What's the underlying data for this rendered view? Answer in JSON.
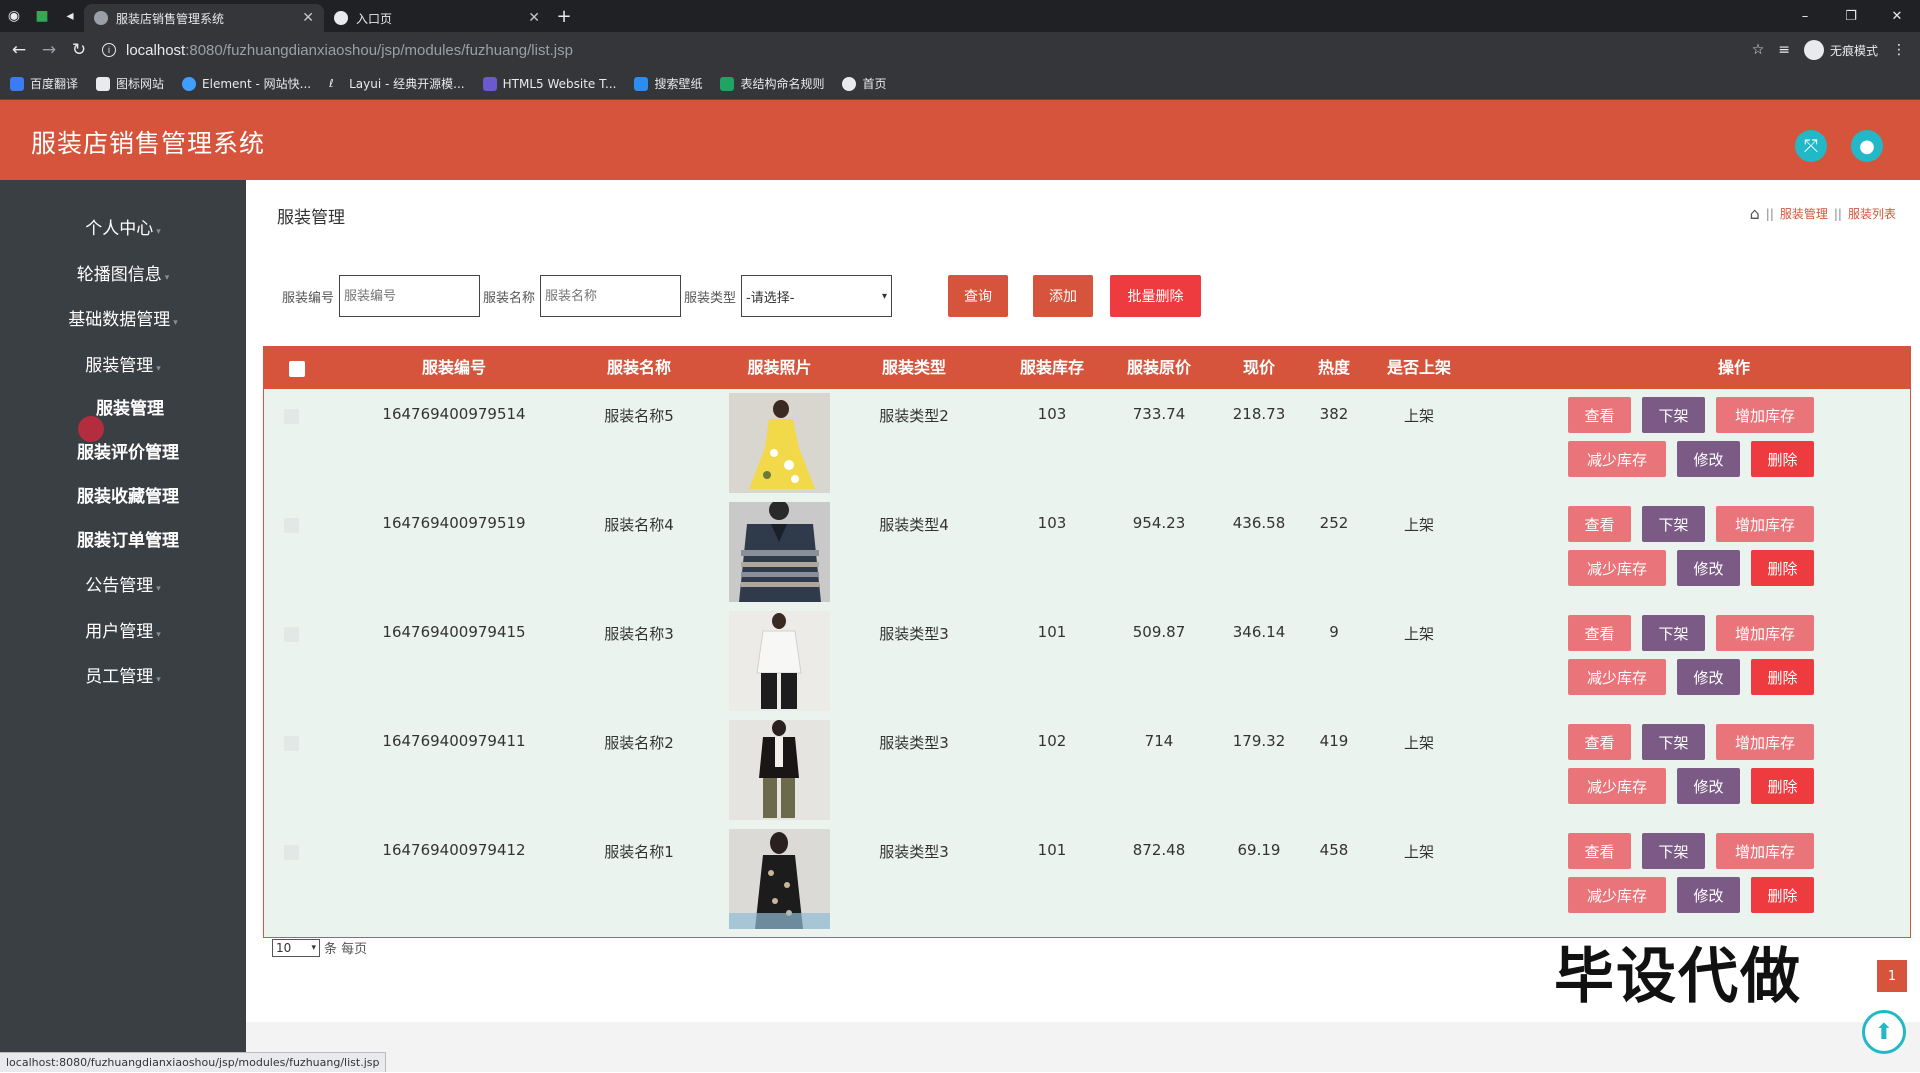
{
  "browser": {
    "tabs": [
      {
        "title": "服装店销售管理系统",
        "active": true
      },
      {
        "title": "入口页",
        "active": false
      }
    ],
    "url_host": "localhost",
    "url_path": ":8080/fuzhuangdianxiaoshou/jsp/modules/fuzhuang/list.jsp",
    "incognito_label": "无痕模式",
    "bookmarks": [
      "百度翻译",
      "图标网站",
      "Element - 网站快...",
      "Layui - 经典开源模...",
      "HTML5 Website T...",
      "搜索壁纸",
      "表结构命名规则",
      "首页"
    ],
    "status_url": "localhost:8080/fuzhuangdianxiaoshou/jsp/modules/fuzhuang/list.jsp"
  },
  "header": {
    "title": "服装店销售管理系统"
  },
  "sidebar": {
    "items": [
      {
        "label": "个人中心",
        "caret": "▾"
      },
      {
        "label": "轮播图信息",
        "caret": "▾"
      },
      {
        "label": "基础数据管理",
        "caret": "▾"
      },
      {
        "label": "服装管理",
        "caret": "▾"
      },
      {
        "label": "服装管理",
        "caret": ""
      },
      {
        "label": "服装评价管理",
        "caret": ""
      },
      {
        "label": "服装收藏管理",
        "caret": ""
      },
      {
        "label": "服装订单管理",
        "caret": ""
      },
      {
        "label": "公告管理",
        "caret": "▾"
      },
      {
        "label": "用户管理",
        "caret": "▾"
      },
      {
        "label": "员工管理",
        "caret": "▾"
      }
    ]
  },
  "main": {
    "page_title": "服装管理",
    "breadcrumb": [
      "服装管理",
      "服装列表"
    ],
    "search": {
      "code_label": "服装编号",
      "code_placeholder": "服装编号",
      "name_label": "服装名称",
      "name_placeholder": "服装名称",
      "type_label": "服装类型",
      "type_value": "-请选择-",
      "query_button": "查询",
      "add_button": "添加",
      "batch_delete_button": "批量删除"
    },
    "table": {
      "columns": [
        "服装编号",
        "服装名称",
        "服装照片",
        "服装类型",
        "服装库存",
        "服装原价",
        "现价",
        "热度",
        "是否上架",
        "操作"
      ],
      "rows": [
        {
          "code": "164769400979514",
          "name": "服装名称5",
          "type": "服装类型2",
          "stock": "103",
          "orig": "733.74",
          "price": "218.73",
          "heat": "382",
          "status": "上架"
        },
        {
          "code": "164769400979519",
          "name": "服装名称4",
          "type": "服装类型4",
          "stock": "103",
          "orig": "954.23",
          "price": "436.58",
          "heat": "252",
          "status": "上架"
        },
        {
          "code": "164769400979415",
          "name": "服装名称3",
          "type": "服装类型3",
          "stock": "101",
          "orig": "509.87",
          "price": "346.14",
          "heat": "9",
          "status": "上架"
        },
        {
          "code": "164769400979411",
          "name": "服装名称2",
          "type": "服装类型3",
          "stock": "102",
          "orig": "714",
          "price": "179.32",
          "heat": "419",
          "status": "上架"
        },
        {
          "code": "164769400979412",
          "name": "服装名称1",
          "type": "服装类型3",
          "stock": "101",
          "orig": "872.48",
          "price": "69.19",
          "heat": "458",
          "status": "上架"
        }
      ],
      "actions": {
        "view": "查看",
        "offshelf": "下架",
        "add_stock": "增加库存",
        "reduce_stock": "减少库存",
        "edit": "修改",
        "delete": "删除"
      }
    },
    "pager": {
      "page_size": "10",
      "per_page_label": "条 每页",
      "current_page": "1"
    },
    "watermark": "毕设代做"
  },
  "colors": {
    "primary": "#d5543b",
    "sidebar": "#3a3f44",
    "teal": "#22b8c8",
    "pink_btn": "#e9757b",
    "purple_btn": "#7b5a85",
    "red_btn": "#ee3b3f"
  }
}
